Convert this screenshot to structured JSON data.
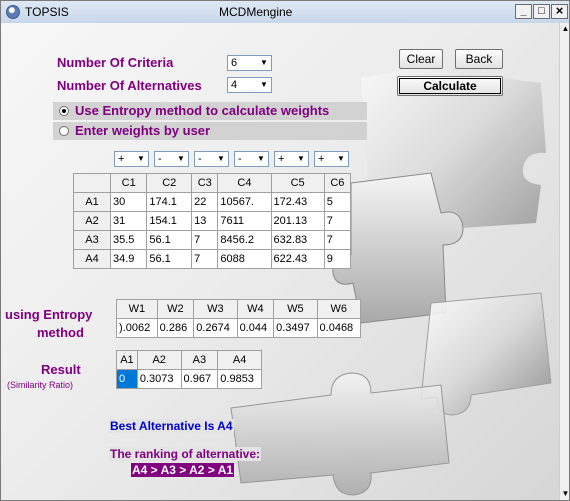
{
  "window": {
    "title": "TOPSIS",
    "subtitle": "MCDMengine",
    "minimize": "_",
    "maximize": "□",
    "close": "×"
  },
  "criteria": {
    "label": "Number Of Criteria",
    "value": "6"
  },
  "alternatives": {
    "label": "Number Of Alternatives",
    "value": "4"
  },
  "buttons": {
    "clear": "Clear",
    "back": "Back",
    "calculate": "Calculate"
  },
  "radios": {
    "entropy": "Use Entropy method to calculate weights",
    "user": "Enter weights by user",
    "selected": "entropy"
  },
  "signs": [
    "+",
    "-",
    "-",
    "-",
    "+",
    "+"
  ],
  "matrix": {
    "headers": [
      "C1",
      "C2",
      "C3",
      "C4",
      "C5",
      "C6"
    ],
    "rows": [
      {
        "name": "A1",
        "values": [
          "30",
          "174.1",
          "22",
          "10567.",
          "172.43",
          "5"
        ]
      },
      {
        "name": "A2",
        "values": [
          "31",
          "154.1",
          "13",
          "7611",
          "201.13",
          "7"
        ]
      },
      {
        "name": "A3",
        "values": [
          "35.5",
          "56.1",
          "7",
          "8456.2",
          "632.83",
          "7"
        ]
      },
      {
        "name": "A4",
        "values": [
          "34.9",
          "56.1",
          "7",
          "6088",
          "622.43",
          "9"
        ]
      }
    ]
  },
  "weights": {
    "label_line1": "using Entropy",
    "label_line2": "method",
    "headers": [
      "W1",
      "W2",
      "W3",
      "W4",
      "W5",
      "W6"
    ],
    "values": [
      ").0062",
      "0.286",
      "0.2674",
      "0.044",
      "0.3497",
      "0.0468"
    ]
  },
  "result": {
    "label": "Result",
    "sublabel": "(Similarity Ratio)",
    "headers": [
      "A1",
      "A2",
      "A3",
      "A4"
    ],
    "values": [
      "0",
      "0.3073",
      "0.967",
      "0.9853"
    ]
  },
  "best": "Best Alternative Is A4",
  "ranking_label": "The ranking of alternative:",
  "ranking": "A4 > A3 > A2 > A1"
}
